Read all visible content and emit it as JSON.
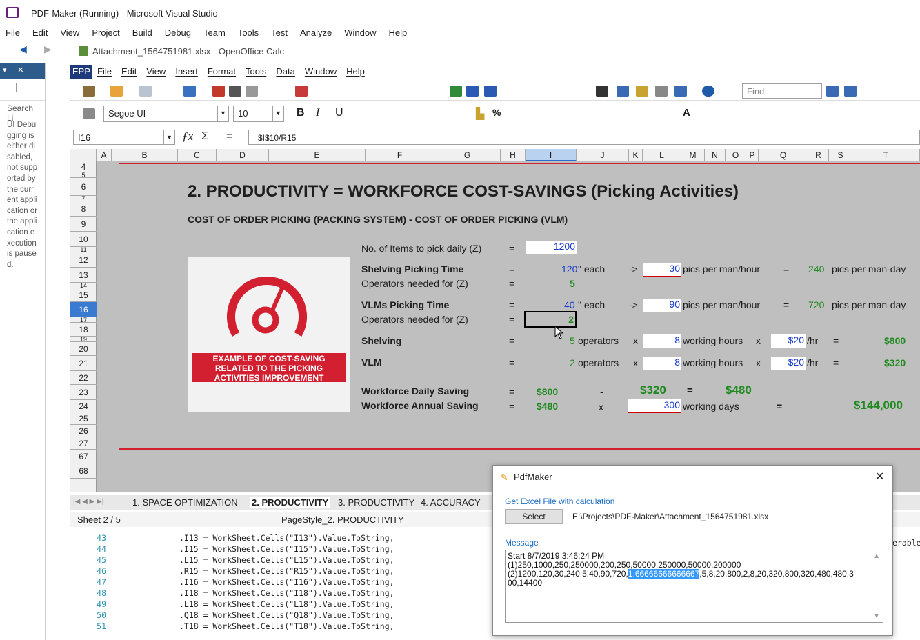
{
  "vs": {
    "title": "PDF-Maker (Running) - Microsoft Visual Studio",
    "menu": [
      "File",
      "Edit",
      "View",
      "Project",
      "Build",
      "Debug",
      "Team",
      "Tools",
      "Test",
      "Analyze",
      "Window",
      "Help"
    ]
  },
  "side_panel": {
    "search_placeholder": "Search Li",
    "message": "UI Debugging is either disabled, not supported by the current application or the application execution is paused."
  },
  "calc": {
    "window_title": "Attachment_1564751981.xlsx - OpenOffice Calc",
    "menu": [
      "EPP",
      "File",
      "Edit",
      "View",
      "Insert",
      "Format",
      "Tools",
      "Data",
      "Window",
      "Help"
    ],
    "find_placeholder": "Find",
    "font_name": "Segoe UI",
    "font_size": "10",
    "cell_ref": "I16",
    "formula": "=$I$10/R15",
    "columns": [
      "A",
      "B",
      "C",
      "D",
      "E",
      "F",
      "G",
      "H",
      "I",
      "J",
      "K",
      "L",
      "M",
      "N",
      "O",
      "P",
      "Q",
      "R",
      "S",
      "T"
    ],
    "rows": [
      "4",
      "5",
      "6",
      "7",
      "8",
      "9",
      "10",
      "11",
      "12",
      "13",
      "14",
      "15",
      "16",
      "17",
      "18",
      "19",
      "20",
      "21",
      "22",
      "23",
      "24",
      "25",
      "26",
      "27",
      "67",
      "68"
    ],
    "heading": "2. PRODUCTIVITY = WORKFORCE COST-SAVINGS (Picking Activities)",
    "subheading": "COST OF ORDER PICKING (PACKING SYSTEM) - COST OF ORDER PICKING (VLM)",
    "image_caption": "EXAMPLE OF COST-SAVING RELATED TO THE PICKING ACTIVITIES IMPROVEMENT",
    "rows_data": {
      "items_label": "No. of Items to pick daily (Z)",
      "items_val": "1200",
      "shelv_label": "Shelving Picking Time",
      "shelv_val": "120",
      "each1": "\" each",
      "arrow1": "->",
      "shelv_pics": "30",
      "pics_per_man_hour1": "pics per man/hour",
      "shelv_day": "240",
      "pics_per_man_day1": "pics per man-day",
      "ops_label1": "Operators needed for (Z)",
      "ops_val1": "5",
      "vlm_label": "VLMs Picking Time",
      "vlm_val": "40",
      "each2": "\" each",
      "arrow2": "->",
      "vlm_pics": "90",
      "pics_per_man_hour2": "pics per man/hour",
      "vlm_day": "720",
      "pics_per_man_day2": "pics per man-day",
      "ops_label2": "Operators needed for (Z)",
      "ops_val2": "2",
      "shelving": "Shelving",
      "shelving_ops": "5",
      "operators": "operators",
      "x": "x",
      "hours1": "8",
      "working_hours": "working hours",
      "rate1": "$20",
      "per_hr": "/hr",
      "cost1": "$800",
      "vlm": "VLM",
      "vlm_ops": "2",
      "hours2": "8",
      "rate2": "$20",
      "cost2": "$320",
      "daily_label": "Workforce Daily Saving",
      "daily_a": "$800",
      "minus": "-",
      "daily_b": "$320",
      "daily_c": "$480",
      "annual_label": "Workforce Annual Saving",
      "annual_a": "$480",
      "days": "300",
      "working_days": "working days",
      "annual_total": "$144,000",
      "eq": "="
    },
    "sheet_tabs": [
      "1. SPACE OPTIMIZATION",
      "2. PRODUCTIVITY",
      "3. PRODUCTIVITY",
      "4. ACCURACY"
    ],
    "status_sheet": "Sheet 2 / 5",
    "status_style": "PageStyle_2. PRODUCTIVITY"
  },
  "code": [
    {
      "ln": "43",
      "text": ".I13 = WorkSheet.Cells(\"I13\").Value.ToString,"
    },
    {
      "ln": "44",
      "text": ".I15 = WorkSheet.Cells(\"I15\").Value.ToString,"
    },
    {
      "ln": "45",
      "text": ".L15 = WorkSheet.Cells(\"L15\").Value.ToString,"
    },
    {
      "ln": "46",
      "text": ".R15 = WorkSheet.Cells(\"R15\").Value.ToString,"
    },
    {
      "ln": "47",
      "text": ".I16 = WorkSheet.Cells(\"I16\").Value.ToString,"
    },
    {
      "ln": "48",
      "text": ".I18 = WorkSheet.Cells(\"I18\").Value.ToString,"
    },
    {
      "ln": "49",
      "text": ".L18 = WorkSheet.Cells(\"L18\").Value.ToString,"
    },
    {
      "ln": "50",
      "text": ".Q18 = WorkSheet.Cells(\"Q18\").Value.ToString,"
    },
    {
      "ln": "51",
      "text": ".T18 = WorkSheet.Cells(\"T18\").Value.ToString,"
    }
  ],
  "code_right": "erable",
  "dialog": {
    "title": "PdfMaker",
    "get_excel_label": "Get Excel File with calculation",
    "select_button": "Select",
    "file_path": "E:\\Projects\\PDF-Maker\\Attachment_1564751981.xlsx",
    "message_label": "Message",
    "message_line1": "Start 8/7/2019 3:46:24 PM",
    "message_line2": "(1)250,1000,250,250000,200,250,50000,250000,50000,200000",
    "message_line3a": "(2)1200,120,30,240,5,40,90,720,",
    "message_line3_selected": "1.66666666666667",
    "message_line3b": ",5,8,20,800,2,8,20,320,800,320,480,480,3",
    "message_line4": "00,14400"
  },
  "colors": {
    "accent": "#1a3ccf",
    "green": "#1f8a1f",
    "red": "#d32030",
    "sheet_bg": "#bfbfbf"
  }
}
